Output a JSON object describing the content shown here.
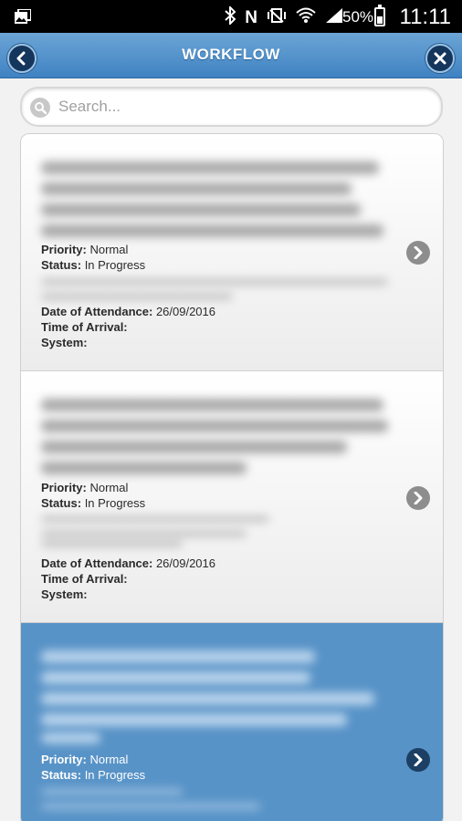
{
  "status_bar": {
    "battery": "50%",
    "time": "11:11",
    "icons": [
      "image-icon",
      "bluetooth-icon",
      "nfc-icon",
      "vibrate-icon",
      "wifi-icon",
      "signal-icon",
      "battery-icon"
    ]
  },
  "header": {
    "title": "WORKFLOW",
    "back_icon": "back-arrow-icon",
    "close_icon": "close-icon",
    "color": "#4f8fcb"
  },
  "search": {
    "placeholder": "Search...",
    "value": ""
  },
  "labels": {
    "priority": "Priority:",
    "status": "Status:",
    "date_of_attendance": "Date of Attendance:",
    "time_of_arrival": "Time of Arrival:",
    "system": "System:"
  },
  "items": [
    {
      "priority": "Normal",
      "status": "In Progress",
      "date_of_attendance": "26/09/2016",
      "time_of_arrival": "",
      "system": "",
      "selected": false
    },
    {
      "priority": "Normal",
      "status": "In Progress",
      "date_of_attendance": "26/09/2016",
      "time_of_arrival": "",
      "system": "",
      "selected": false
    },
    {
      "priority": "Normal",
      "status": "In Progress",
      "selected": true
    }
  ],
  "colors": {
    "selected_row": "#5893c7",
    "header_top": "#6ca5d6",
    "header_bottom": "#3f82c2"
  }
}
